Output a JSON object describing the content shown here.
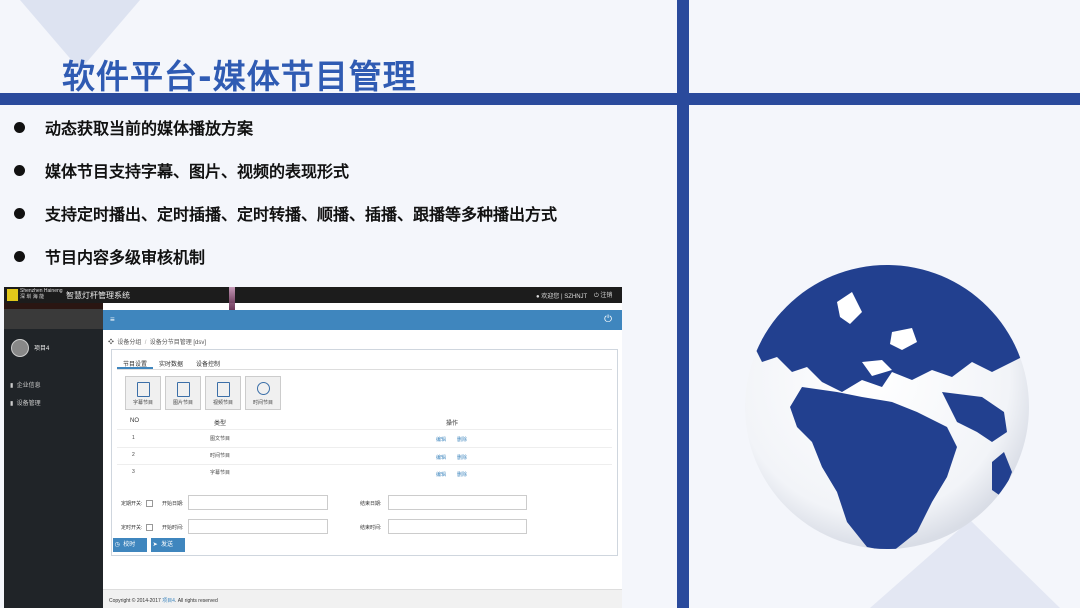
{
  "slide": {
    "title": "软件平台-媒体节目管理",
    "bullets": [
      "动态获取当前的媒体播放方案",
      "媒体节目支持字幕、图片、视频的表现形式",
      "支持定时播出、定时插播、定时转播、顺播、插播、跟播等多种播出方式",
      "节目内容多级审核机制"
    ],
    "accent": "#2a4a9c"
  },
  "app": {
    "logo_en": "Shenzhen Haineng",
    "logo_cn": "深 圳 海 能",
    "title": "智慧灯杆管理系统",
    "welcome": "欢迎您 | SZHNJT",
    "logout": "注销",
    "user": "项目4",
    "sidebar": [
      "企业信息",
      "设备管理"
    ],
    "breadcrumb": [
      "设备分组",
      "设备分节目管理 [dsv]"
    ],
    "tabs": [
      "节目设置",
      "实时数据",
      "设备控制"
    ],
    "tools": [
      "字幕节目",
      "图片节目",
      "视频节目",
      "时间节目"
    ],
    "table": {
      "headers": [
        "NO",
        "类型",
        "操作"
      ],
      "rows": [
        {
          "no": "1",
          "type": "图文节目",
          "edit": "编辑",
          "del": "删除"
        },
        {
          "no": "2",
          "type": "时间节目",
          "edit": "编辑",
          "del": "删除"
        },
        {
          "no": "3",
          "type": "字幕节目",
          "edit": "编辑",
          "del": "删除"
        }
      ]
    },
    "form": {
      "date_switch": "定期开关:",
      "start_date": "开始日期:",
      "end_date": "结束日期:",
      "time_switch": "定时开关:",
      "start_time": "开始时间:",
      "end_time": "结束时间:"
    },
    "buttons": [
      "校时",
      "发送"
    ],
    "copyright_pre": "Copyright © 2014-2017",
    "copyright_link": "项目4",
    "copyright_post": ". All rights reserved"
  }
}
